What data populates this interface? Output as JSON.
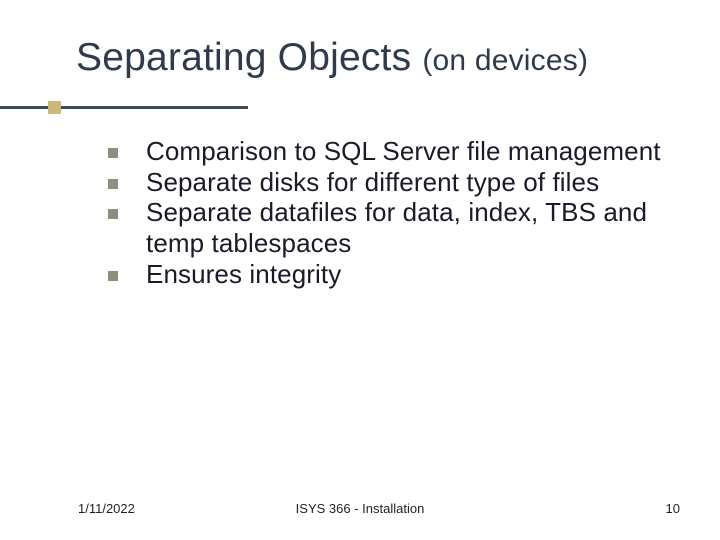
{
  "title": {
    "main": "Separating Objects ",
    "sub": "(on devices)"
  },
  "bullets": [
    "Comparison to SQL Server file management",
    "Separate disks for different type of files",
    "Separate datafiles for data, index, TBS and temp  tablespaces",
    "Ensures integrity"
  ],
  "footer": {
    "date": "1/11/2022",
    "course": "ISYS 366 - Installation",
    "page": "10"
  }
}
